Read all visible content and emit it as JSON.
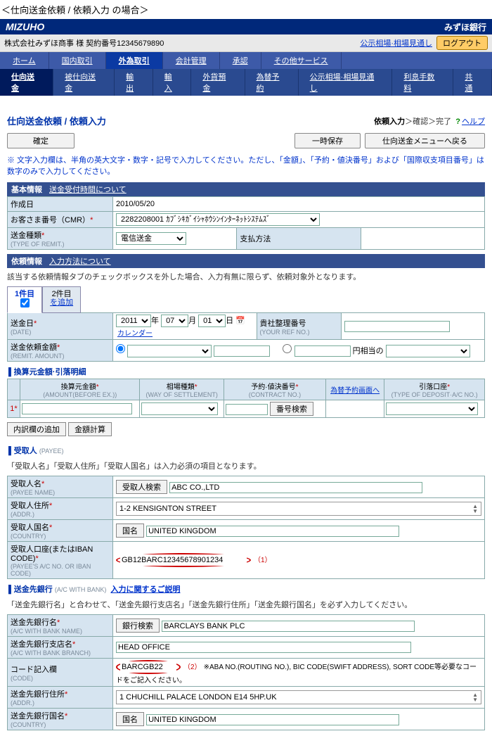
{
  "outer_title": "＜仕向送金依頼 / 依頼入力 の場合＞",
  "header": {
    "logo": "MIZUHO",
    "bank": "みずほ銀行"
  },
  "subheader": {
    "company": "株式会社みずほ商事",
    "contract": "様 契約番号12345679890",
    "rate_link": "公示相場·相場見通し",
    "logout": "ログアウト"
  },
  "nav1": [
    "ホーム",
    "国内取引",
    "外為取引",
    "会計管理",
    "承認",
    "その他サービス"
  ],
  "nav1_active": 2,
  "nav2": [
    "仕向送金",
    "被仕向送金",
    "輸出",
    "輸入",
    "外貨預金",
    "為替予約",
    "公示相場·相場見通し",
    "利息手数料",
    "共通"
  ],
  "nav2_active": 0,
  "page": {
    "title": "仕向送金依頼 / 依頼入力",
    "progress_cur": "依頼入力",
    "progress_rest": "＞確認＞完了",
    "help": "ヘルプ"
  },
  "buttons": {
    "confirm": "確定",
    "save": "一時保存",
    "back_menu": "仕向送金メニューへ戻る"
  },
  "note_blue": "※ 文字入力欄は、半角の英大文字・数字・記号で入力してください。ただし、「金額」、「予約・値決番号」および「国際収支項目番号」は数字のみで入力してください。",
  "basic": {
    "hdr": "基本情報",
    "link": "送金受付時間について",
    "rows": {
      "created": {
        "lbl": "作成日",
        "val": "2010/05/20"
      },
      "cmr": {
        "lbl": "お客さま番号（CMR）",
        "val": "2282208001 ｶﾌﾞｼｷｶﾞｲｼｬﾎｳｼﾝｲﾝﾀｰﾈｯﾄｼｽﾃﾑｽﾞ"
      },
      "remit_type": {
        "lbl": "送金種類",
        "eng": "(TYPE OF REMIT.)",
        "val": "電信送金",
        "paymethod_lbl": "支払方法"
      }
    }
  },
  "req_info": {
    "hdr": "依頼情報",
    "link": "入力方法について",
    "sub": "該当する依頼情報タブのチェックボックスを外した場合、入力有無に限らず、依頼対象外となります。",
    "tab1": "1件目",
    "tab2_l1": "2件目",
    "tab2_l2": "を追加"
  },
  "date_row": {
    "lbl": "送金日",
    "eng": "(DATE)",
    "year": "2011",
    "month": "07",
    "day": "01",
    "y_suf": "年",
    "m_suf": "月",
    "d_suf": "日",
    "cal": "カレンダー",
    "ref_lbl": "貴社整理番号",
    "ref_eng": "(YOUR REF NO.)"
  },
  "amount_row": {
    "lbl": "送金依頼金額",
    "eng": "(REMIT. AMOUNT)",
    "equiv": "円相当の"
  },
  "exchange": {
    "hdr": "換算元金額·引落明細",
    "cols": {
      "amt": {
        "lbl": "換算元金額",
        "eng": "(AMOUNT(BEFORE EX.))"
      },
      "way": {
        "lbl": "相場種類",
        "eng": "(WAY OF SETTLEMENT)"
      },
      "contract": {
        "lbl": "予約·値決番号",
        "eng": "(CONTRACT NO.)"
      },
      "fx_link": "為替予約画面へ",
      "deposit": {
        "lbl": "引落口座",
        "eng": "(TYPE OF DEPOSIT·A/C NO.)"
      }
    },
    "row_num": "1",
    "search_btn": "番号検索",
    "add_btn": "内訳欄の追加",
    "calc_btn": "金額計算"
  },
  "payee": {
    "hdr": "受取人",
    "hdr_eng": "(PAYEE)",
    "sub": "「受取人名」「受取人住所」「受取人国名」は入力必須の項目となります。",
    "rows": {
      "name": {
        "lbl": "受取人名",
        "eng": "(PAYEE NAME)",
        "btn": "受取人検索",
        "val": "ABC CO.,LTD"
      },
      "addr": {
        "lbl": "受取人住所",
        "eng": "(ADDR.)",
        "val": "1-2 KENSIGNTON STREET"
      },
      "country": {
        "lbl": "受取人国名",
        "eng": "(COUNTRY)",
        "btn": "国名",
        "val": "UNITED KINGDOM"
      },
      "iban": {
        "lbl": "受取人口座(またはIBAN CODE)",
        "eng": "(PAYEE'S A/C NO. OR IBAN CODE)",
        "val": "GB12BARC12345678901234",
        "anno": "（1）"
      }
    }
  },
  "bank": {
    "hdr": "送金先銀行",
    "hdr_eng": "(A/C WITH BANK)",
    "link": "入力に関するご説明",
    "sub": "「送金先銀行名」と合わせて、「送金先銀行支店名」「送金先銀行住所」「送金先銀行国名」を必ず入力してください。",
    "rows": {
      "name": {
        "lbl": "送金先銀行名",
        "eng": "(A/C WITH BANK NAME)",
        "btn": "銀行検索",
        "val": "BARCLAYS BANK PLC"
      },
      "branch": {
        "lbl": "送金先銀行支店名",
        "eng": "(A/C WITH BANK BRANCH)",
        "val": "HEAD OFFICE"
      },
      "code": {
        "lbl": "コード記入欄",
        "eng": "(CODE)",
        "val": "BARCGB22",
        "anno": "（2）",
        "note": "※ABA NO.(ROUTING NO.), BIC CODE(SWIFT ADDRESS), SORT CODE等必要なコードをご記入ください。"
      },
      "addr": {
        "lbl": "送金先銀行住所",
        "eng": "(ADDR.)",
        "val": "1 CHUCHILL PALACE LONDON E14 5HP.UK"
      },
      "country": {
        "lbl": "送金先銀行国名",
        "eng": "(COUNTRY)",
        "btn": "国名",
        "val": "UNITED KINGDOM"
      }
    }
  }
}
